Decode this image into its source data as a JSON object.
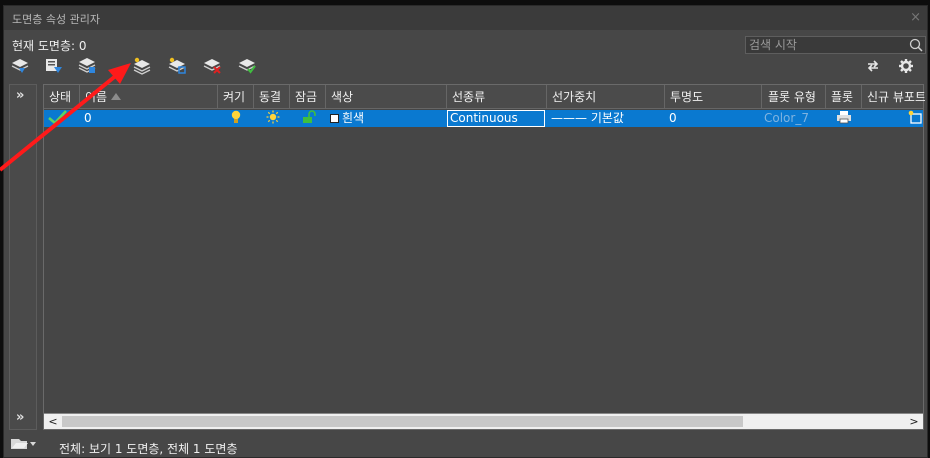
{
  "window": {
    "title": "도면층 속성 관리자",
    "close": "×"
  },
  "current_layer": "현재 도면층: 0",
  "search": {
    "placeholder": "검색 시작"
  },
  "toolbar": {
    "icons": [
      "layer-state-icon",
      "new-property-filter-icon",
      "new-group-filter-icon",
      "new-layer-icon",
      "new-vp-frozen-layer-icon",
      "delete-layer-icon",
      "set-current-icon"
    ],
    "right_icons": [
      "refresh-icon",
      "settings-icon"
    ]
  },
  "expand_glyph": "»",
  "columns": [
    "상태",
    "이름",
    "켜기",
    "동결",
    "잠금",
    "색상",
    "선종류",
    "선가중치",
    "투명도",
    "플롯 유형",
    "플롯",
    "신규 뷰포트"
  ],
  "rows": [
    {
      "status": "current",
      "name": "0",
      "on": true,
      "frozen": false,
      "locked": false,
      "color": "흰색",
      "color_hex": "#ffffff",
      "linetype": "Continuous",
      "lineweight": "——— 기본값",
      "transparency": "0",
      "plot_style": "Color_7",
      "plot": true
    }
  ],
  "status_bar": "전체: 보기 1 도면층, 전체 1 도면층",
  "colors": {
    "selection": "#0a79d0",
    "background": "#474747",
    "annotation_arrow": "#ff1a1a"
  }
}
